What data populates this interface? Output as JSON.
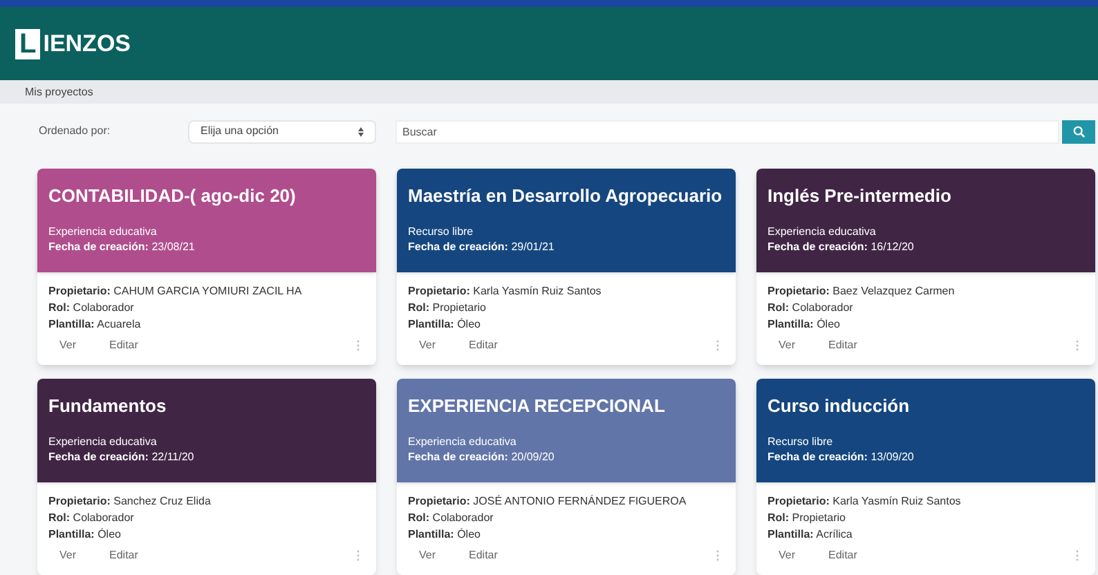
{
  "header": {
    "logo_letter": "L",
    "logo_rest": "IENZOS"
  },
  "breadcrumb": "Mis proyectos",
  "filters": {
    "sort_label": "Ordenado por:",
    "sort_select": "Elija una opción",
    "search": {
      "placeholder": "Buscar"
    }
  },
  "cards": [
    {
      "title": "CONTABILIDAD-( ago-dic 20)",
      "color": "#b04d8c",
      "type": "Experiencia educativa",
      "date": "**Fecha de creación:** 23/08/21",
      "owner": "**Propietario:** CAHUM GARCIA YOMIURI ZACIL HA",
      "role": "**Rol:** Colaborador",
      "template": "**Plantilla:** Acuarela",
      "actions": [
        "Ver",
        "Editar"
      ]
    },
    {
      "title": "Maestría en Desarrollo Agropecuario",
      "color": "#15467f",
      "type": "Recurso libre",
      "date": "**Fecha de creación:** 29/01/21",
      "owner": "**Propietario:** Karla Yasmín Ruiz Santos",
      "role": "**Rol:** Propietario",
      "template": "**Plantilla:** Óleo",
      "actions": [
        "Ver",
        "Editar"
      ]
    },
    {
      "title": "Inglés Pre-intermedio",
      "color": "#412545",
      "type": "Experiencia educativa",
      "date": "**Fecha de creación:** 16/12/20",
      "owner": "**Propietario:** Baez Velazquez Carmen",
      "role": "**Rol:** Colaborador",
      "template": "**Plantilla:** Óleo",
      "actions": [
        "Ver",
        "Editar"
      ]
    },
    {
      "title": "Fundamentos",
      "color": "#412545",
      "type": "Experiencia educativa",
      "date": "**Fecha de creación:** 22/11/20",
      "owner": "**Propietario:** Sanchez Cruz Elida",
      "role": "**Rol:** Colaborador",
      "template": "**Plantilla:** Óleo",
      "actions": [
        "Ver",
        "Editar"
      ]
    },
    {
      "title": "EXPERIENCIA RECEPCIONAL",
      "color": "#6275a8",
      "type": "Experiencia educativa",
      "date": "**Fecha de creación:** 20/09/20",
      "owner": "**Propietario:** JOSÉ ANTONIO FERNÁNDEZ FIGUEROA",
      "role": "**Rol:** Colaborador",
      "template": "**Plantilla:** Óleo",
      "actions": [
        "Ver",
        "Editar"
      ]
    },
    {
      "title": "Curso inducción",
      "color": "#15467f",
      "type": "Recurso libre",
      "date": "**Fecha de creación:** 13/09/20",
      "owner": "**Propietario:** Karla Yasmín Ruiz Santos",
      "role": "**Rol:** Propietario",
      "template": "**Plantilla:** Acrílica",
      "actions": [
        "Ver",
        "Editar"
      ]
    }
  ]
}
